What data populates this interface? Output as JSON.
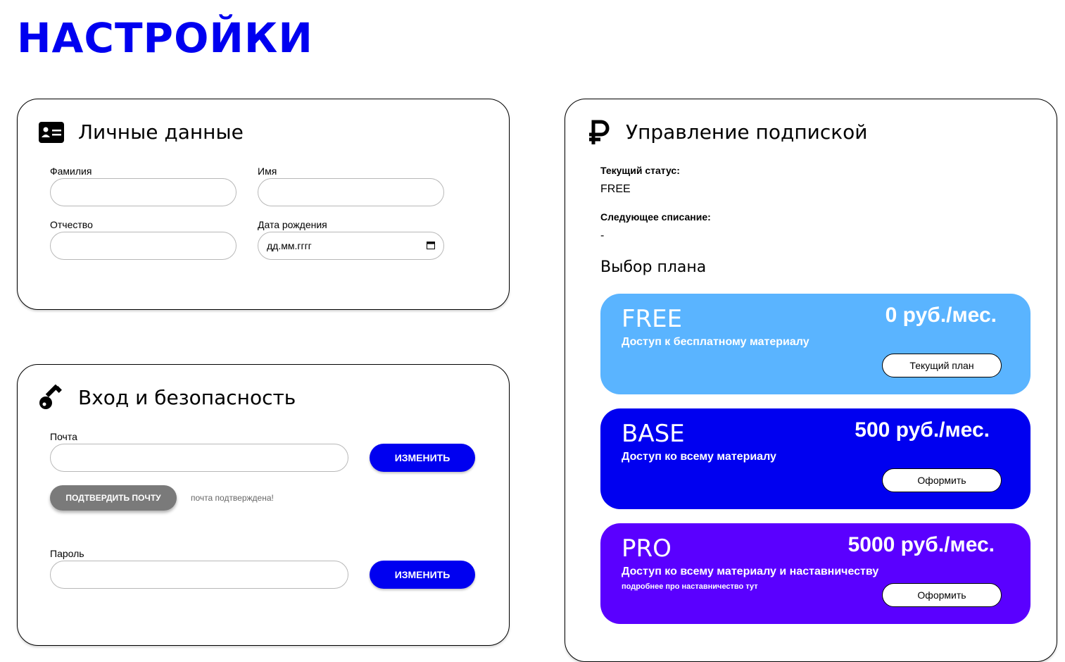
{
  "page": {
    "title": "НАСТРОЙКИ"
  },
  "personal": {
    "title": "Личные данные",
    "icon": "id-card-icon",
    "last_name_label": "Фамилия",
    "first_name_label": "Имя",
    "middle_name_label": "Отчество",
    "birth_date_label": "Дата рождения",
    "last_name_value": "",
    "first_name_value": "",
    "middle_name_value": "",
    "birth_date_placeholder": "дд.мм.гггг"
  },
  "security": {
    "title": "Вход и безопасность",
    "icon": "key-icon",
    "email_label": "Почта",
    "email_value": "",
    "change_email_label": "ИЗМЕНИТЬ",
    "confirm_email_label": "ПОДТВЕРДИТЬ ПОЧТУ",
    "email_status": "почта подтверждена!",
    "password_label": "Пароль",
    "password_value": "",
    "change_password_label": "ИЗМЕНИТЬ"
  },
  "subscription": {
    "title": "Управление подпиской",
    "icon": "ruble-icon",
    "status_label": "Текущий статус:",
    "status_value": "FREE",
    "next_charge_label": "Следующее списание:",
    "next_charge_value": "-",
    "plan_choice_title": "Выбор плана",
    "plans": [
      {
        "name": "FREE",
        "price": "0 руб./мес.",
        "description": "Доступ к бесплатному материалу",
        "note": "",
        "button": "Текущий план",
        "color": "#5ab4ff"
      },
      {
        "name": "BASE",
        "price": "500 руб./мес.",
        "description": "Доступ ко всему материалу",
        "note": "",
        "button": "Оформить",
        "color": "#0000f0"
      },
      {
        "name": "PRO",
        "price": "5000 руб./мес.",
        "description": "Доступ ко всему материалу и наставничеству",
        "note": "подробнее про наставничество тут",
        "button": "Оформить",
        "color": "#5a00ff"
      }
    ]
  }
}
